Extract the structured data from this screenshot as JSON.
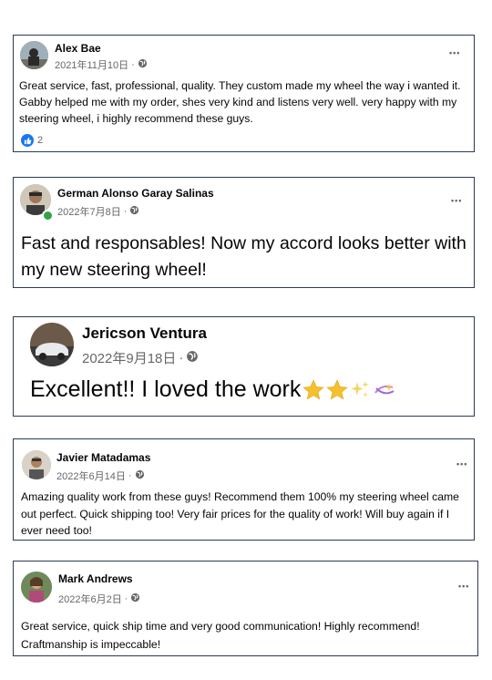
{
  "reviews": [
    {
      "name": "Alex Bae",
      "date": "2021年11月10日",
      "dot": "·",
      "more": "•••",
      "text": "Great service, fast, professional, quality. They custom made my wheel the way i wanted it. Gabby helped me with my order, shes very kind and listens very well. very happy with my steering wheel, i highly recommend these guys.",
      "likes": "2"
    },
    {
      "name": "German Alonso Garay Salinas",
      "date": "2022年7月8日",
      "dot": "·",
      "more": "•••",
      "text": "Fast and responsables! Now my accord looks better with my new steering wheel!"
    },
    {
      "name": "Jericson Ventura",
      "date": "2022年9月18日",
      "dot": "·",
      "text": "Excellent!! I loved the work"
    },
    {
      "name": "Javier Matadamas",
      "date": "2022年6月14日",
      "dot": "·",
      "more": "•••",
      "text": "Amazing quality work from these guys! Recommend them 100% my steering wheel came out perfect. Quick shipping too! Very fair prices for the quality of work! Will buy again if I ever need too!"
    },
    {
      "name": "Mark Andrews",
      "date": "2022年6月2日",
      "dot": "·",
      "more": "•••",
      "text": "Great service, quick ship time and very good communication! Highly recommend! Craftmanship is impeccable!"
    }
  ],
  "colors": {
    "like_blue": "#1877f2",
    "online_green": "#31a24c",
    "meta_gray": "#65676b",
    "border": "#2b3a55"
  }
}
